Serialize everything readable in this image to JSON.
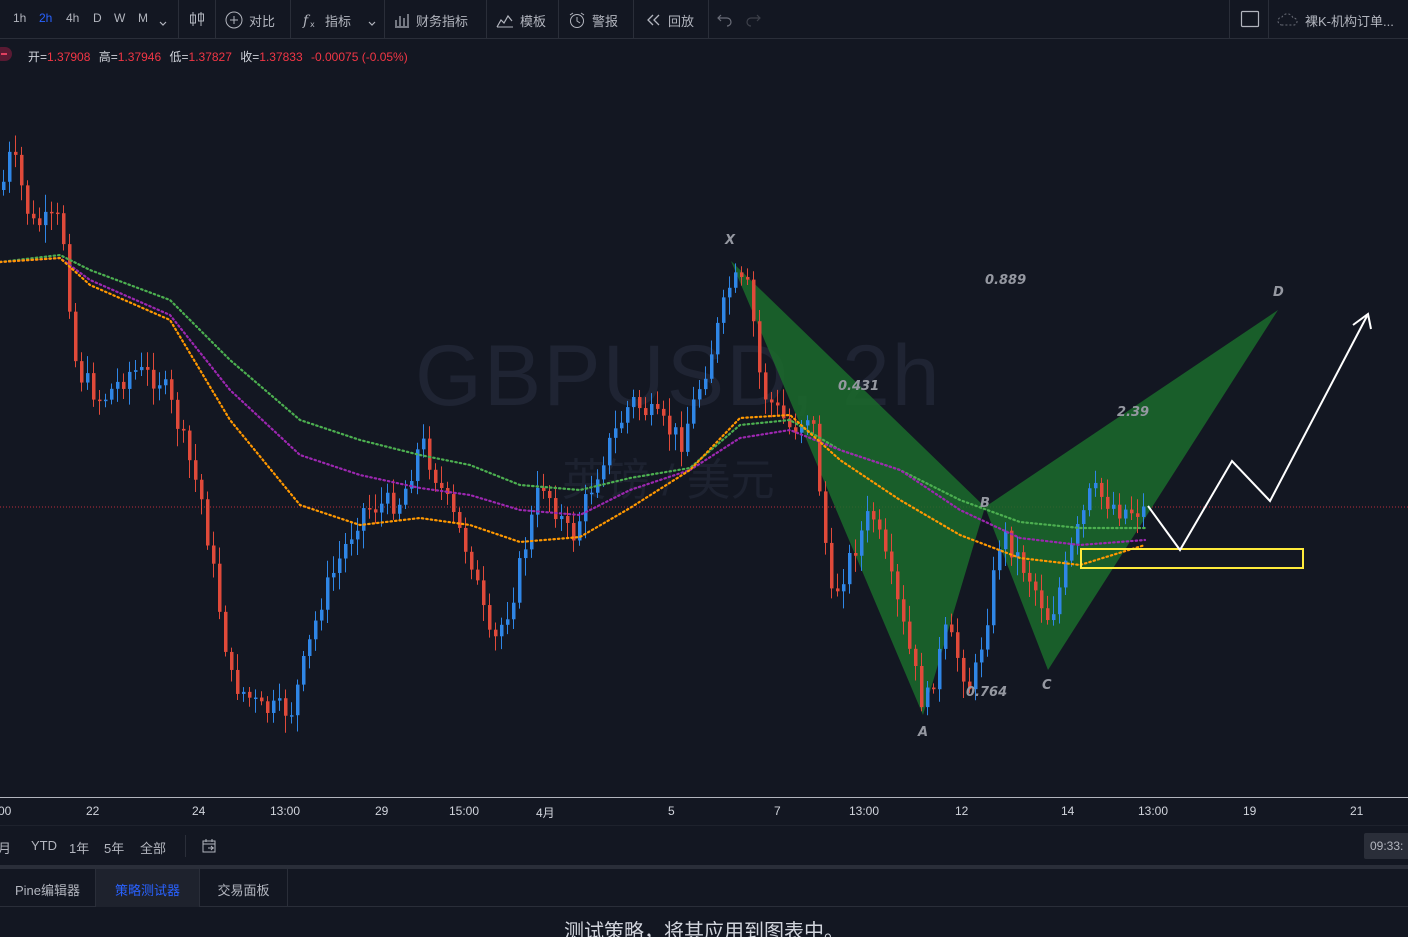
{
  "toolbar": {
    "timeframes": [
      "1h",
      "2h",
      "4h",
      "D",
      "W",
      "M"
    ],
    "compare_label": "对比",
    "indicators_label": "指标",
    "financials_label": "财务指标",
    "templates_label": "模板",
    "alerts_label": "警报",
    "replay_label": "回放",
    "layout_name": "裸K-机构订单..."
  },
  "legend": {
    "open_label": "开=",
    "open": "1.37908",
    "high_label": "高=",
    "high": "1.37946",
    "low_label": "低=",
    "low": "1.37827",
    "close_label": "收=",
    "close": "1.37833",
    "change": "-0.00075 (-0.05%)"
  },
  "chart": {
    "symbol_watermark": "GBPUSD, 2h",
    "symbol_desc_watermark": "英镑 / 美元",
    "pattern_points": {
      "x": "X",
      "a": "A",
      "b": "B",
      "c": "C",
      "d": "D"
    },
    "ratios": {
      "xb": "0.431",
      "ac": "0.889",
      "bd": "2.39",
      "xd": "0.764"
    },
    "colors": {
      "up": "#2f86e6",
      "down": "#e04a3a",
      "pattern_fill": "#1b6b2c",
      "zone": "#ffeb3b",
      "ma_green": "#4caf50",
      "ma_purple": "#9c27b0",
      "ma_orange": "#ff9800",
      "projection": "#ffffff"
    }
  },
  "time_axis": {
    "labels": [
      "00",
      "22",
      "24",
      "13:00",
      "29",
      "15:00",
      "4月",
      "5",
      "7",
      "13:00",
      "12",
      "14",
      "13:00",
      "19",
      "21"
    ]
  },
  "range_bar": {
    "ranges": [
      "月",
      "YTD",
      "1年",
      "5年",
      "全部"
    ],
    "clock": "09:33:"
  },
  "panel": {
    "tabs": [
      "Pine编辑器",
      "策略测试器",
      "交易面板"
    ],
    "active_tab": "策略测试器",
    "message": "测试策略，将其应用到图表中。"
  }
}
